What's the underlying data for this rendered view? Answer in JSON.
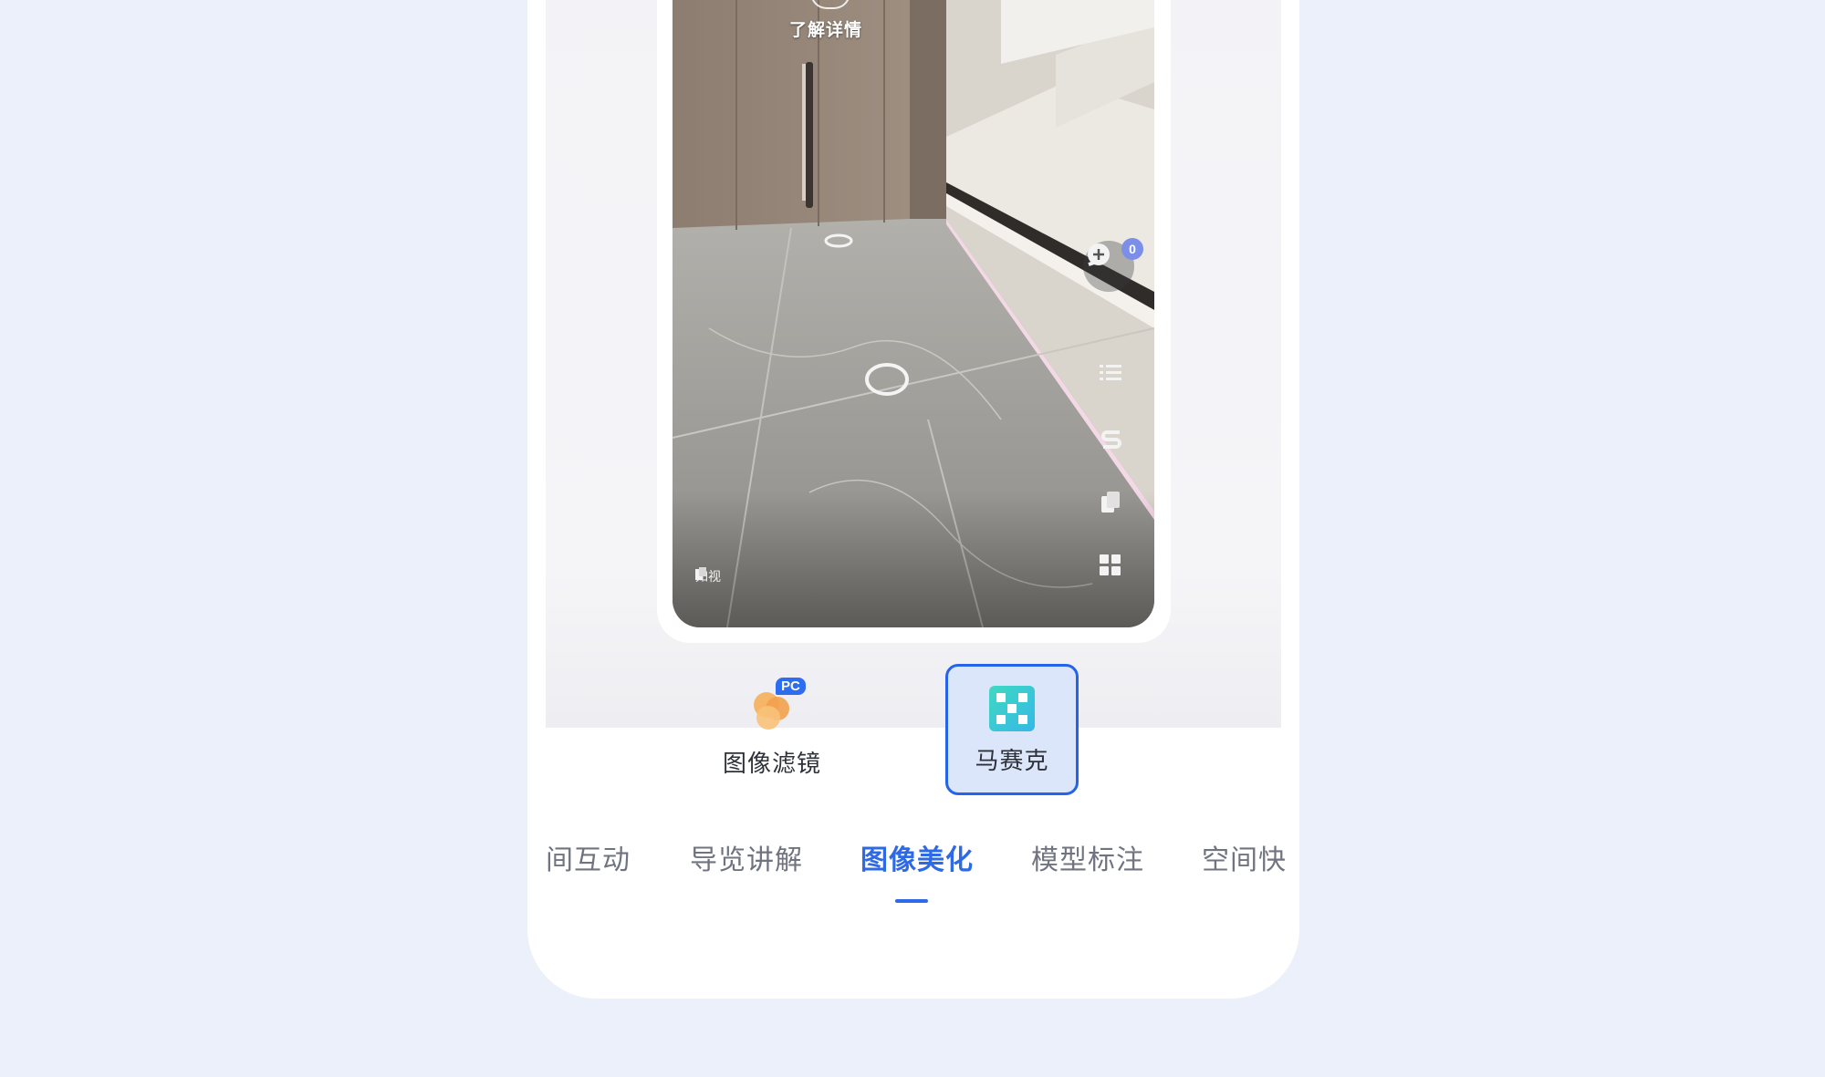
{
  "preview": {
    "learn_more": "了解详情",
    "comment_count": "0",
    "watermark": "如视"
  },
  "features": [
    {
      "label": "图像滤镜",
      "badge": "PC",
      "icon": "filter-icon",
      "active": false
    },
    {
      "label": "马赛克",
      "icon": "mosaic-icon",
      "active": true
    }
  ],
  "tabs": [
    {
      "label": "间互动"
    },
    {
      "label": "导览讲解"
    },
    {
      "label": "图像美化",
      "active": true
    },
    {
      "label": "模型标注"
    },
    {
      "label": "空间快"
    }
  ],
  "colors": {
    "background": "#ebf0fa",
    "accent": "#2e6ae6",
    "active_border": "#2563eb",
    "active_fill": "#dce6fb"
  }
}
